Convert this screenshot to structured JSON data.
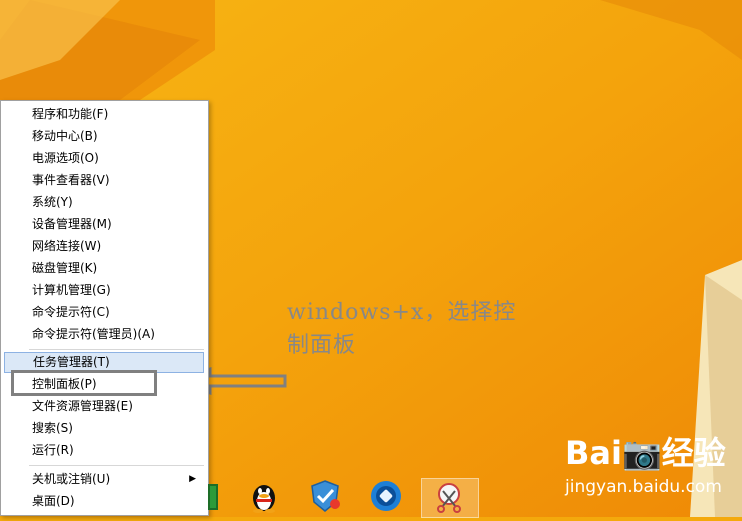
{
  "annotation": {
    "line1": "windows+x，选择控",
    "line2": "制面板"
  },
  "watermark": {
    "logo": "Bai📷经验",
    "url": "jingyan.baidu.com"
  },
  "menu": {
    "items": [
      {
        "label": "程序和功能(F)"
      },
      {
        "label": "移动中心(B)"
      },
      {
        "label": "电源选项(O)"
      },
      {
        "label": "事件查看器(V)"
      },
      {
        "label": "系统(Y)"
      },
      {
        "label": "设备管理器(M)"
      },
      {
        "label": "网络连接(W)"
      },
      {
        "label": "磁盘管理(K)"
      },
      {
        "label": "计算机管理(G)"
      },
      {
        "label": "命令提示符(C)"
      },
      {
        "label": "命令提示符(管理员)(A)"
      },
      {
        "label": "任务管理器(T)"
      },
      {
        "label": "控制面板(P)"
      },
      {
        "label": "文件资源管理器(E)"
      },
      {
        "label": "搜索(S)"
      },
      {
        "label": "运行(R)"
      },
      {
        "label": "关机或注销(U)"
      },
      {
        "label": "桌面(D)"
      }
    ]
  },
  "colors": {
    "desktop": "#f4a90c",
    "menu_hover": "#dbe8f7",
    "highlight_box": "#808080"
  },
  "taskbar": {
    "icons": [
      "store-icon",
      "qq-penguin-icon",
      "security-shield-icon",
      "browser-icon",
      "snipping-tool-icon"
    ]
  }
}
